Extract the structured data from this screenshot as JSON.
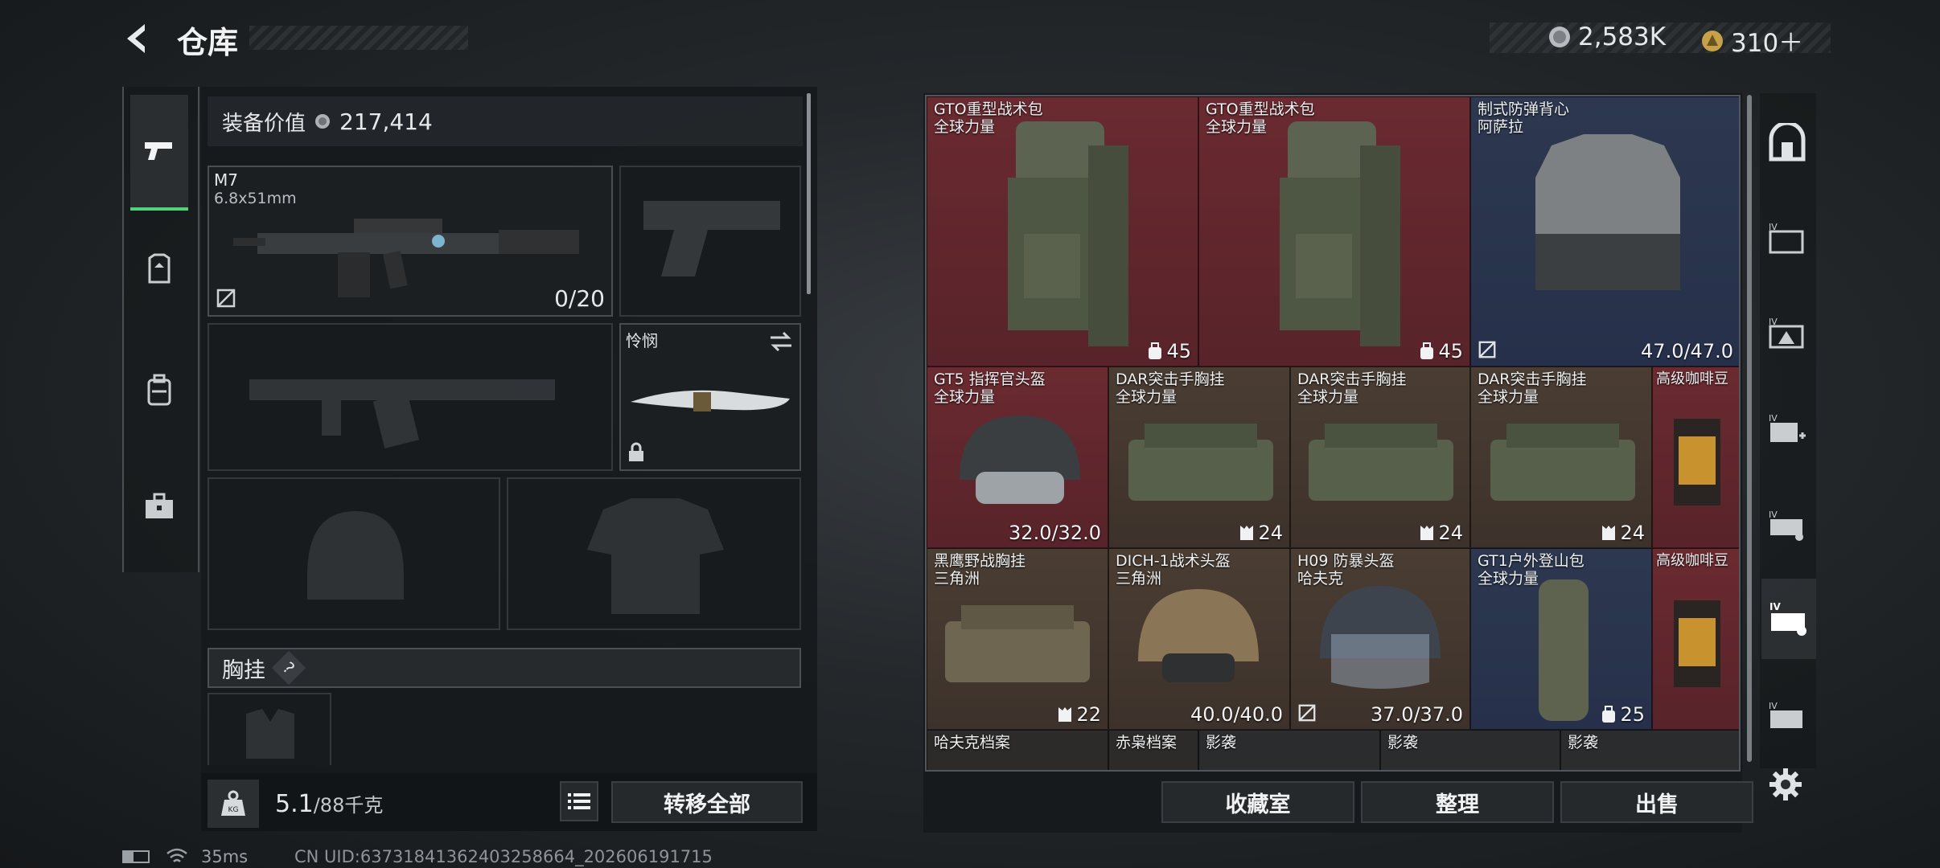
{
  "header": {
    "title": "仓库",
    "currency_1": "2,583K",
    "currency_2": "310＋"
  },
  "equipment": {
    "value_label": "装备价值",
    "value": "217,414",
    "primary": {
      "name": "M7",
      "ammo": "6.8x51mm",
      "count": "0/20"
    },
    "melee": {
      "name": "怜悯"
    },
    "chest_rig_label": "胸挂",
    "help": "?"
  },
  "bottom_left": {
    "weight": "5.1",
    "weight_unit": "/88千克",
    "transfer_all": "转移全部"
  },
  "status": {
    "ping": "35ms",
    "uid": "CN UID:63731841362403258664_202606191715"
  },
  "grid": {
    "c1": {
      "name": "GTO重型战术包",
      "sub": "全球力量",
      "val": "45"
    },
    "c2": {
      "name": "GTO重型战术包",
      "sub": "全球力量",
      "val": "45"
    },
    "c3": {
      "name": "制式防弹背心",
      "sub": "阿萨拉",
      "val": "47.0/47.0"
    },
    "c4": {
      "name": "GT5 指挥官头盔",
      "sub": "全球力量",
      "val": "32.0/32.0"
    },
    "c5": {
      "name": "DAR突击手胸挂",
      "sub": "全球力量",
      "val": "24"
    },
    "c6": {
      "name": "DAR突击手胸挂",
      "sub": "全球力量",
      "val": "24"
    },
    "c7": {
      "name": "DAR突击手胸挂",
      "sub": "全球力量",
      "val": "24"
    },
    "c8": {
      "name": "高级咖啡豆"
    },
    "c9": {
      "name": "黑鹰野战胸挂",
      "sub": "三角洲",
      "val": "22"
    },
    "c10": {
      "name": "DICH-1战术头盔",
      "sub": "三角洲",
      "val": "40.0/40.0"
    },
    "c11": {
      "name": "H09 防暴头盔",
      "sub": "哈夫克",
      "val": "37.0/37.0"
    },
    "c12": {
      "name": "GT1户外登山包",
      "sub": "全球力量",
      "val": "25"
    },
    "c13": {
      "name": "高级咖啡豆"
    },
    "r4": [
      "哈夫克档案",
      "赤枭档案",
      "影袭",
      "影袭",
      "影袭"
    ]
  },
  "actions": {
    "collection": "收藏室",
    "sort": "整理",
    "sell": "出售"
  },
  "colors": {
    "red": "#5e262c",
    "blue": "#2a3450",
    "brown": "#43372f",
    "accent": "#4fd27a"
  }
}
